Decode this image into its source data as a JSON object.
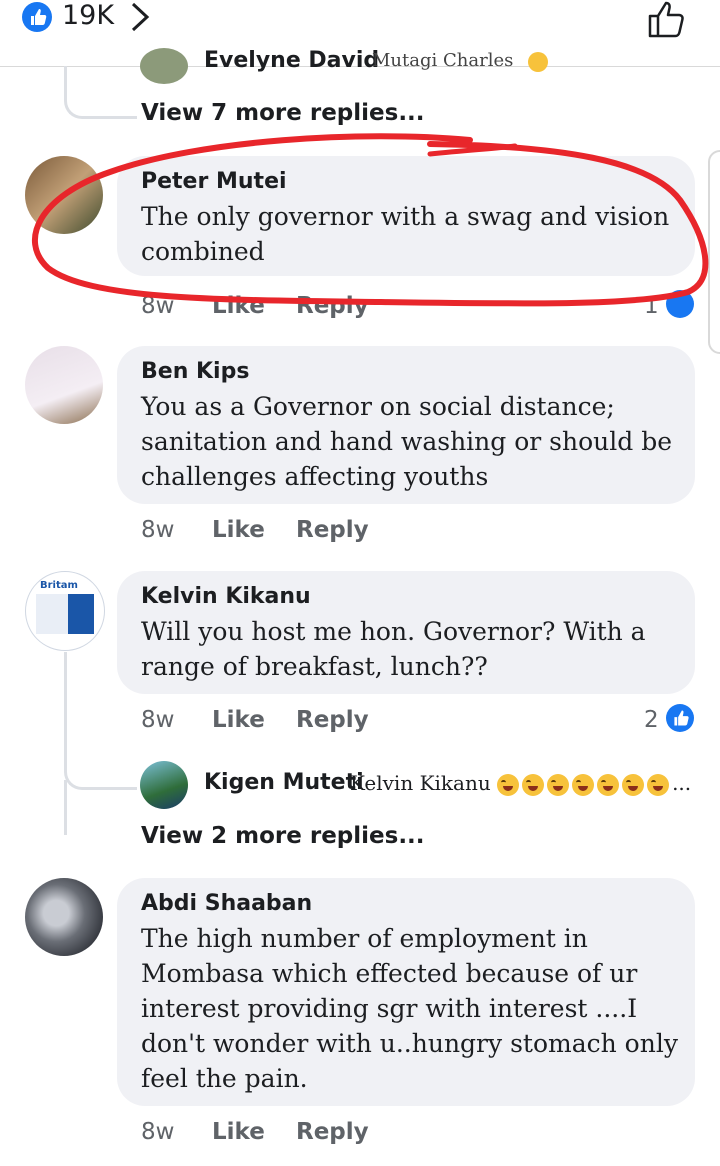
{
  "header": {
    "like_count": "19K"
  },
  "top_reply": {
    "name": "Evelyne David",
    "text": "Mutagi Charles"
  },
  "view_more_1": "View 7 more replies...",
  "comments": [
    {
      "name": "Peter Mutei",
      "lines": [
        "The only governor with a swag and vision",
        "combined"
      ],
      "time": "8w",
      "like": "Like",
      "reply": "Reply",
      "reactions": "1"
    },
    {
      "name": "Ben Kips",
      "lines": [
        "You as a  Governor  on social distance;",
        "sanitation  and  hand washing  or  should be",
        "challenges  affecting  youths"
      ],
      "time": "8w",
      "like": "Like",
      "reply": "Reply"
    },
    {
      "name": "Kelvin Kikanu",
      "lines": [
        "Will you host me hon. Governor? With a",
        "range of breakfast, lunch??"
      ],
      "time": "8w",
      "like": "Like",
      "reply": "Reply",
      "reactions": "2",
      "avatar_text": "Britam"
    },
    {
      "name": "Abdi Shaaban",
      "lines": [
        "The high number of employment in",
        "Mombasa which effected because of ur",
        "interest providing sgr with interest   ....I",
        "don't wonder with u..hungry stomach only",
        "feel the pain."
      ],
      "time": "8w",
      "like": "Like",
      "reply": "Reply"
    }
  ],
  "nested_reply": {
    "name": "Kigen Muteti",
    "text": "Kelvin Kikanu",
    "suffix": "..."
  },
  "view_more_2": "View 2 more replies...",
  "colors": {
    "accent": "#1877f2",
    "annotation": "#e8262b",
    "bubble": "#f0f1f5"
  }
}
